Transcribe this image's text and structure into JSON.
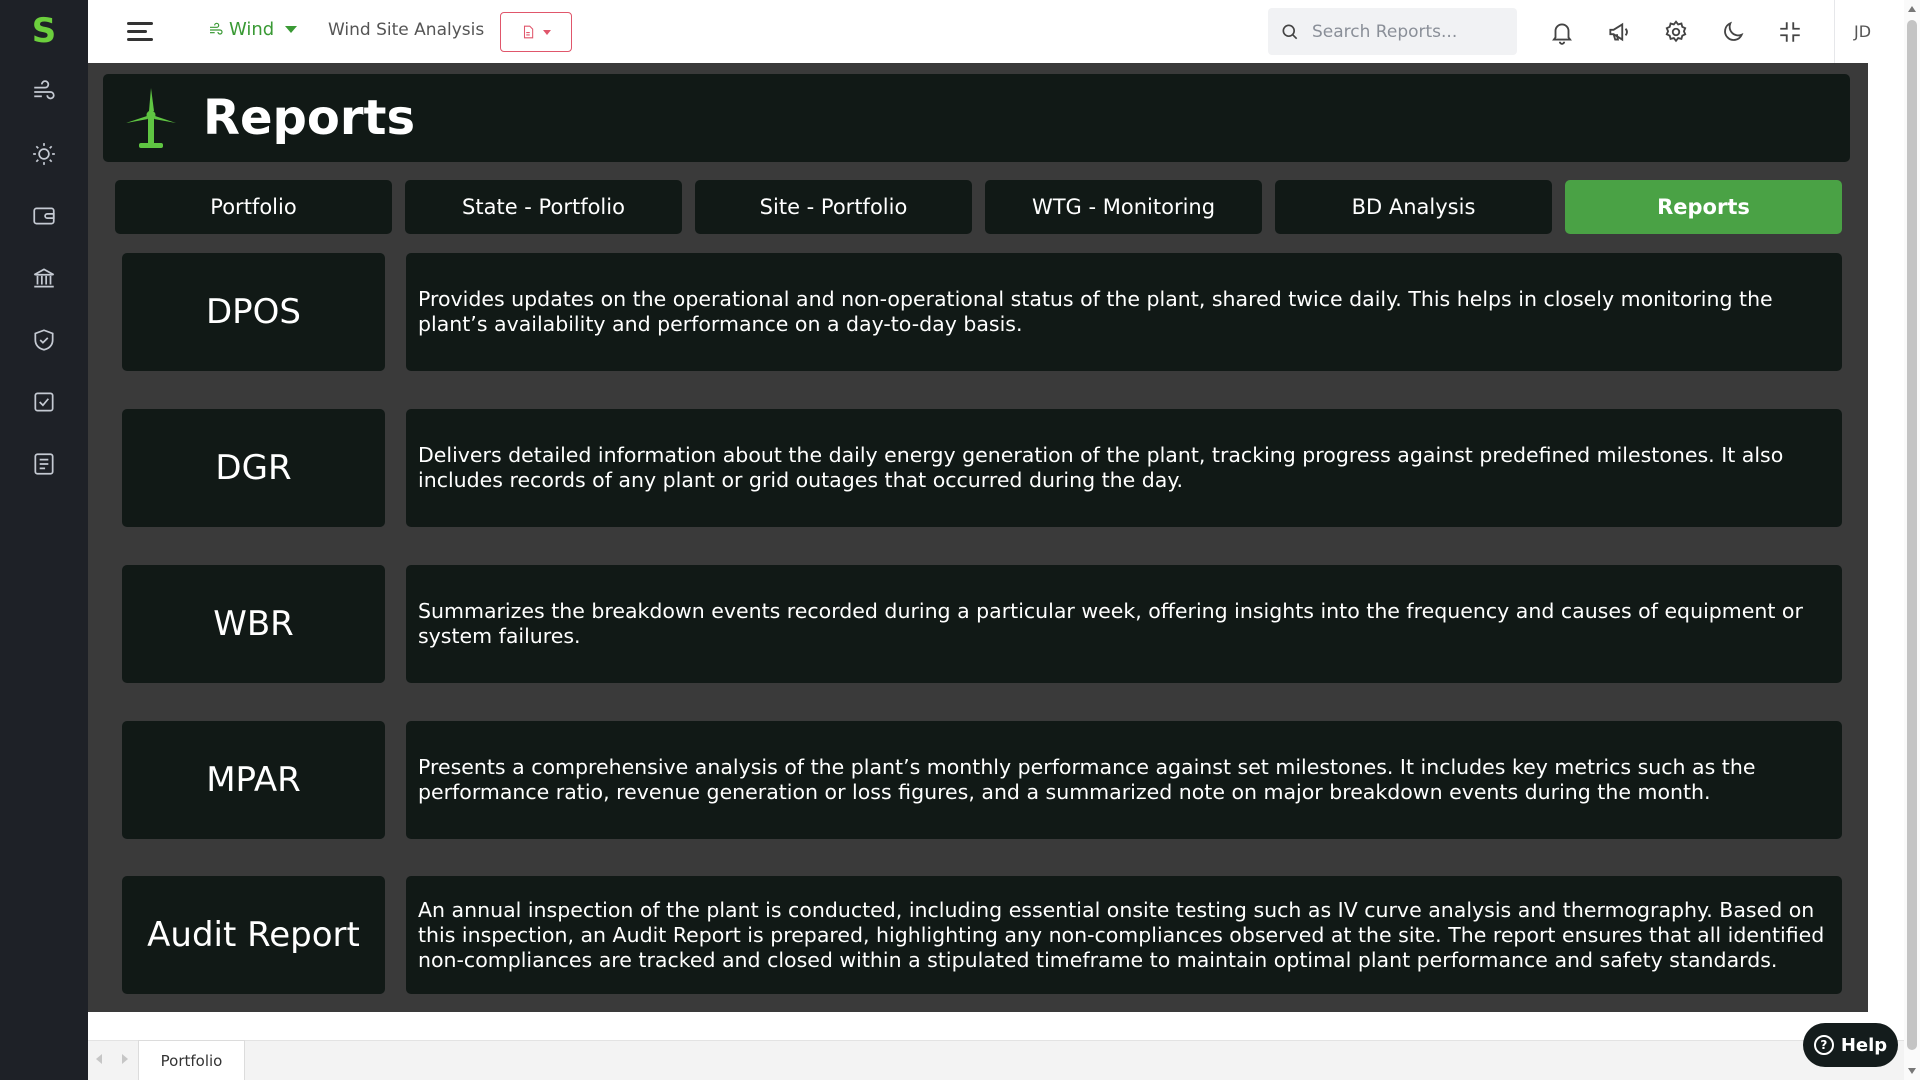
{
  "sidebar": {
    "logo_text": "S",
    "items": [
      {
        "icon": "wind-icon"
      },
      {
        "icon": "sun-icon"
      },
      {
        "icon": "wallet-icon"
      },
      {
        "icon": "bank-icon"
      },
      {
        "icon": "shield-check-icon"
      },
      {
        "icon": "checkbox-icon"
      },
      {
        "icon": "report-list-icon"
      }
    ]
  },
  "topbar": {
    "domain_label": "Wind",
    "site_title": "Wind Site Analysis",
    "search_placeholder": "Search Reports...",
    "user_initials": "JD",
    "icons": [
      "bell-icon",
      "megaphone-icon",
      "settings-icon",
      "moon-icon",
      "fullscreen-exit-icon"
    ]
  },
  "page": {
    "title": "Reports"
  },
  "tabs": [
    {
      "label": "Portfolio",
      "active": false
    },
    {
      "label": "State - Portfolio",
      "active": false
    },
    {
      "label": "Site - Portfolio",
      "active": false
    },
    {
      "label": "WTG - Monitoring",
      "active": false
    },
    {
      "label": "BD Analysis",
      "active": false
    },
    {
      "label": "Reports",
      "active": true
    }
  ],
  "reports": [
    {
      "name": "DPOS",
      "description": "Provides updates on the operational and non-operational status of the plant, shared twice daily. This helps in closely monitoring the plant’s availability and performance on a day-to-day basis."
    },
    {
      "name": "DGR",
      "description": "Delivers detailed information about the daily energy generation of the plant, tracking progress against predefined milestones. It also includes records of any plant or grid outages that occurred during the day."
    },
    {
      "name": "WBR",
      "description": "Summarizes the breakdown events recorded during a particular week, offering insights into the frequency and causes of equipment or system failures."
    },
    {
      "name": "MPAR",
      "description": "Presents a comprehensive analysis of the plant’s monthly performance against set milestones. It includes key metrics such as the performance ratio, revenue generation or loss figures, and a summarized note on major breakdown events during the month."
    },
    {
      "name": "Audit Report",
      "description": "An annual inspection of the plant is conducted, including essential onsite testing such as IV curve analysis and thermography. Based on this inspection, an Audit Report is prepared, highlighting any non-compliances observed at the site. The report ensures that all identified non-compliances are tracked and closed within a stipulated timeframe to maintain optimal plant performance and safety standards."
    }
  ],
  "bottom_tabs": [
    {
      "label": "Portfolio"
    }
  ],
  "help": {
    "label": "Help"
  },
  "colors": {
    "accent_green": "#4aa245",
    "card_dark": "#111916",
    "content_bg": "#3a3a3a",
    "sidebar_bg": "#1e2127",
    "report_button_red": "#e0566b"
  }
}
